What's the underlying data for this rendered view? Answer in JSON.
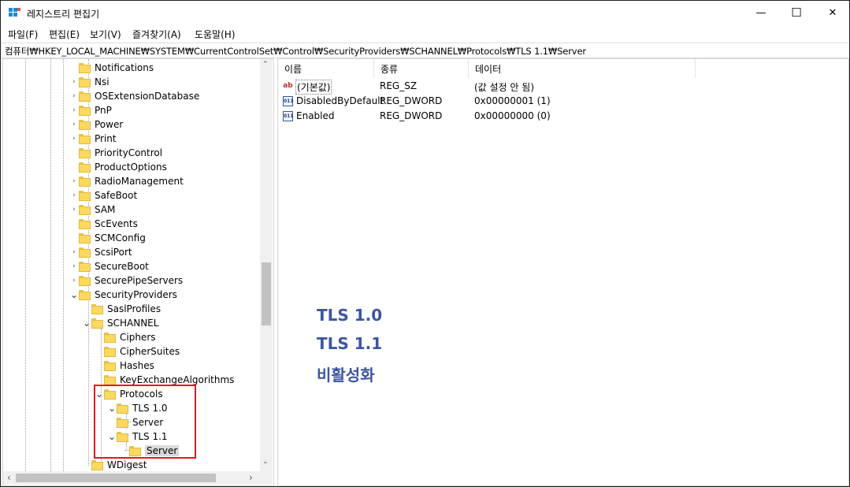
{
  "window": {
    "title": "레지스트리 편집기",
    "minimize": "—",
    "maximize": "☐",
    "close": "✕"
  },
  "menu": [
    "파일(F)",
    "편집(E)",
    "보기(V)",
    "즐겨찾기(A)",
    "도움말(H)"
  ],
  "address": "컴퓨터₩HKEY_LOCAL_MACHINE₩SYSTEM₩CurrentControlSet₩Control₩SecurityProviders₩SCHANNEL₩Protocols₩TLS 1.1₩Server",
  "tree": [
    {
      "label": "Notifications",
      "expander": ""
    },
    {
      "label": "Nsi",
      "expander": "›"
    },
    {
      "label": "OSExtensionDatabase",
      "expander": "›"
    },
    {
      "label": "PnP",
      "expander": "›"
    },
    {
      "label": "Power",
      "expander": "›"
    },
    {
      "label": "Print",
      "expander": "›"
    },
    {
      "label": "PriorityControl",
      "expander": ""
    },
    {
      "label": "ProductOptions",
      "expander": ""
    },
    {
      "label": "RadioManagement",
      "expander": "›"
    },
    {
      "label": "SafeBoot",
      "expander": "›"
    },
    {
      "label": "SAM",
      "expander": "›"
    },
    {
      "label": "ScEvents",
      "expander": ""
    },
    {
      "label": "SCMConfig",
      "expander": ""
    },
    {
      "label": "ScsiPort",
      "expander": "›"
    },
    {
      "label": "SecureBoot",
      "expander": "›"
    },
    {
      "label": "SecurePipeServers",
      "expander": "›"
    },
    {
      "label": "SecurityProviders",
      "expander": "⌄"
    },
    {
      "label": "SaslProfiles",
      "expander": ""
    },
    {
      "label": "SCHANNEL",
      "expander": "⌄"
    },
    {
      "label": "Ciphers",
      "expander": ""
    },
    {
      "label": "CipherSuites",
      "expander": ""
    },
    {
      "label": "Hashes",
      "expander": ""
    },
    {
      "label": "KeyExchangeAlgorithms",
      "expander": ""
    },
    {
      "label": "Protocols",
      "expander": "⌄"
    },
    {
      "label": "TLS 1.0",
      "expander": "⌄"
    },
    {
      "label": "Server",
      "expander": ""
    },
    {
      "label": "TLS 1.1",
      "expander": "⌄"
    },
    {
      "label": "Server",
      "expander": ""
    },
    {
      "label": "WDigest",
      "expander": ""
    }
  ],
  "columns": {
    "name": "이름",
    "type": "종류",
    "data": "데이터"
  },
  "values": [
    {
      "icon": "ab",
      "name": "(기본값)",
      "type": "REG_SZ",
      "data": "(값 설정 안 됨)"
    },
    {
      "icon": "011",
      "name": "DisabledByDefault",
      "type": "REG_DWORD",
      "data": "0x00000001 (1)"
    },
    {
      "icon": "011",
      "name": "Enabled",
      "type": "REG_DWORD",
      "data": "0x00000000 (0)"
    }
  ],
  "annotation": [
    "TLS 1.0",
    "TLS 1.1",
    "비활성화"
  ],
  "colors": {
    "annotation": "#3d55a0",
    "highlight": "#e3191e",
    "folder": "#fbd961"
  },
  "scroll": {
    "up": "⌃",
    "down": "⌄",
    "left": "‹",
    "right": "›"
  }
}
